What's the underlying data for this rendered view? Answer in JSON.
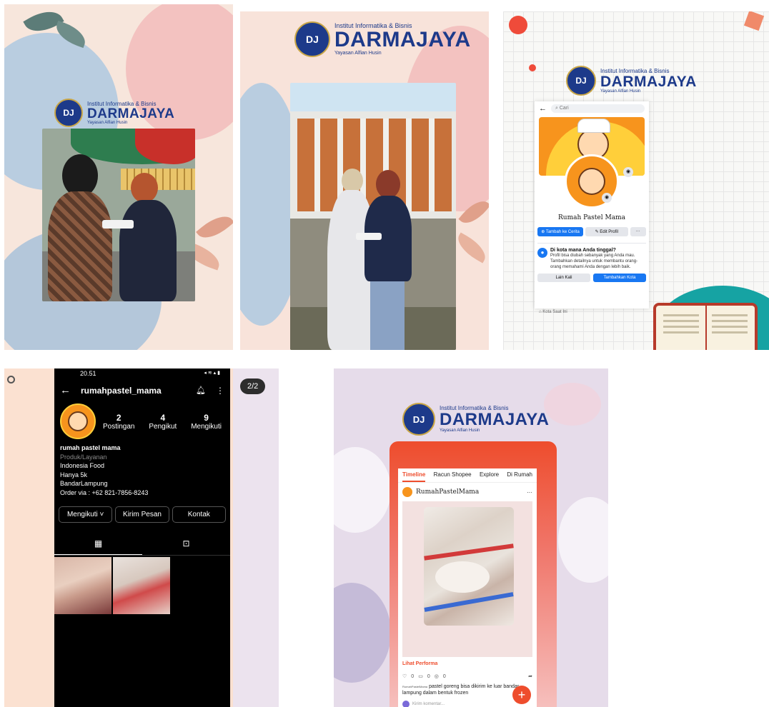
{
  "brand": {
    "institute": "Institut Informatika & Bisnis",
    "name": "DARMAJAYA",
    "foundation": "Yayasan Alfian Husin",
    "seal_text": "DJ",
    "color": "#1d3a8a"
  },
  "facebook": {
    "search_placeholder": "Cari",
    "page_name": "Rumah Pastel Mama",
    "add_story": "Tambah ke Cerita",
    "edit_profile": "Edit Profil",
    "more": "···",
    "location_title": "Di kota mana Anda tinggal?",
    "location_body": "Profil bisa diubah sebanyak yang Anda mau. Tambahkan detailnya untuk membantu orang-orang memahami Anda dengan lebih baik.",
    "later": "Lain Kali",
    "add_city": "Tambahkan Kota",
    "footer_hint": "Kota Saat Ini"
  },
  "instagram": {
    "time": "20.51",
    "status_icons": "◂ ≋ ▴ ▮",
    "username": "rumahpastel_mama",
    "page_indicator": "2/2",
    "stats": [
      {
        "value": "2",
        "label": "Postingan"
      },
      {
        "value": "4",
        "label": "Pengikut"
      },
      {
        "value": "9",
        "label": "Mengikuti"
      }
    ],
    "bio_name": "rumah pastel mama",
    "bio_category": "Produk/Layanan",
    "bio_lines": [
      "Indonesia Food",
      "Hanya 5k",
      "BandarLampung",
      "Order via : +62 821-7856-8243"
    ],
    "follow_button": "Mengikuti ˅",
    "message_button": "Kirim Pesan",
    "contact_button": "Kontak"
  },
  "shopee": {
    "tabs": [
      "Timeline",
      "Racun Shopee",
      "Explore",
      "Di Rumah"
    ],
    "account": "RumahPastelMama",
    "more": "···",
    "performance": "Lihat Performa",
    "likes": "0",
    "comments": "0",
    "views": "0",
    "caption_author": "RumahPastelMama",
    "caption": "pastel goreng bisa dikirim ke luar bandar lampung dalam bentuk frozen",
    "comment_placeholder": "Kirim komentar...",
    "fab": "+"
  },
  "colors": {
    "facebook_blue": "#1877f2",
    "shopee_orange": "#ee4d2d",
    "instagram_bg": "#000000"
  }
}
